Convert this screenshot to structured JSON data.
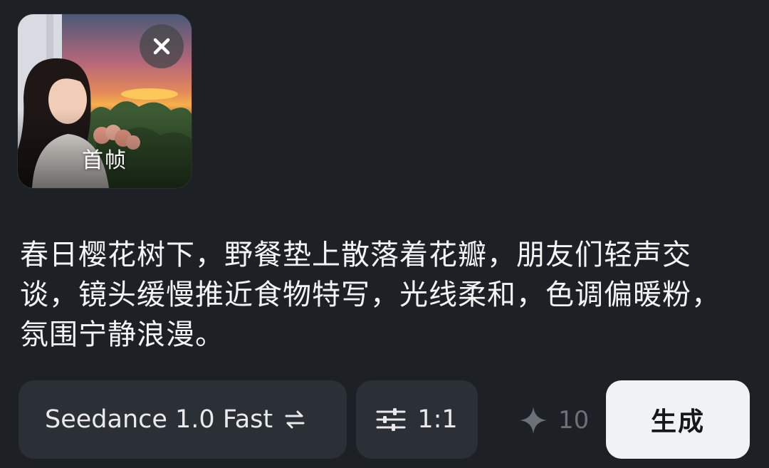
{
  "first_frame": {
    "label": "首帧",
    "thumbnail_icon": "portrait-sunset-photo"
  },
  "close_button": {
    "icon": "close-icon"
  },
  "prompt": {
    "text": "春日樱花树下，野餐垫上散落着花瓣，朋友们轻声交谈，镜头缓慢推近食物特写，光线柔和，色调偏暖粉，氛围宁静浪漫。"
  },
  "toolbar": {
    "model_label": "Seedance 1.0 Fast",
    "model_icon": "swap-arrows-icon",
    "ratio_label": "1:1",
    "ratio_icon": "sliders-icon",
    "credits_icon": "sparkle-icon",
    "credits_value": "10",
    "generate_label": "生成"
  },
  "colors": {
    "background": "#1d2024",
    "pill_background": "#2b2f36",
    "generate_background": "#f1f2f4",
    "muted_text": "#6c7078"
  }
}
